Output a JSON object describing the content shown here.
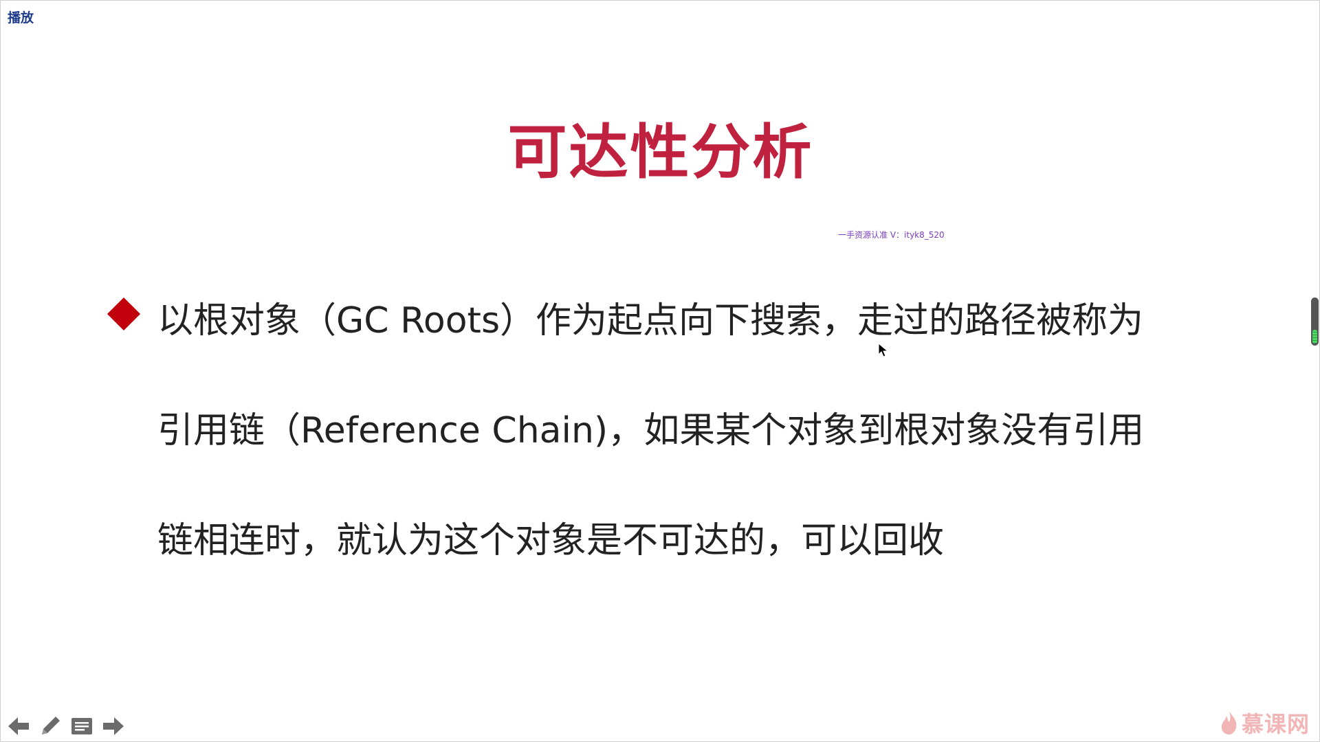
{
  "header": {
    "play_label": "播放"
  },
  "slide": {
    "title": "可达性分析",
    "watermark": "一手资源认准 V：ityk8_520",
    "bullet_lines": [
      "以根对象（GC Roots）作为起点向下搜索，走过的路径被称为",
      "引用链（Reference Chain)，如果某个对象到根对象没有引用",
      "链相连时，就认为这个对象是不可达的，可以回收"
    ]
  },
  "toolbar": {
    "items": [
      {
        "icon": "arrow-left-icon"
      },
      {
        "icon": "pen-icon"
      },
      {
        "icon": "menu-icon"
      },
      {
        "icon": "arrow-right-icon"
      }
    ]
  },
  "brand": {
    "name": "慕课网",
    "icon": "flame-icon"
  },
  "colors": {
    "title": "#c0213f",
    "bullet": "#c0000b",
    "body_text": "#222222",
    "watermark": "#7a3dbf",
    "brand": "#f2b5b5"
  }
}
